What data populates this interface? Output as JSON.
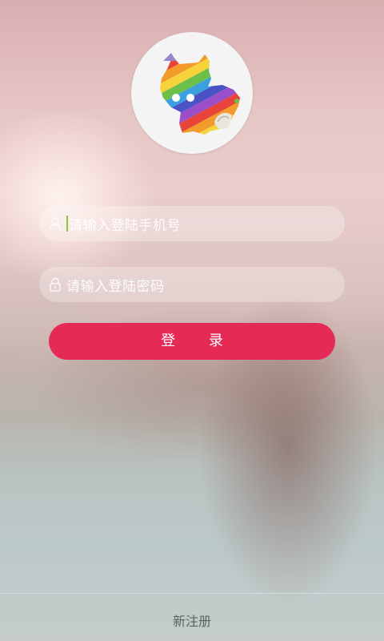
{
  "login": {
    "phone_placeholder": "请输入登陆手机号",
    "password_placeholder": "请输入登陆密码",
    "login_button": "登 录"
  },
  "footer": {
    "register_label": "新注册"
  },
  "icons": {
    "logo": "rainbow-calf-logo",
    "user": "user-icon",
    "lock": "lock-icon"
  },
  "colors": {
    "accent": "#e62a56",
    "caret": "#8cc63f"
  }
}
